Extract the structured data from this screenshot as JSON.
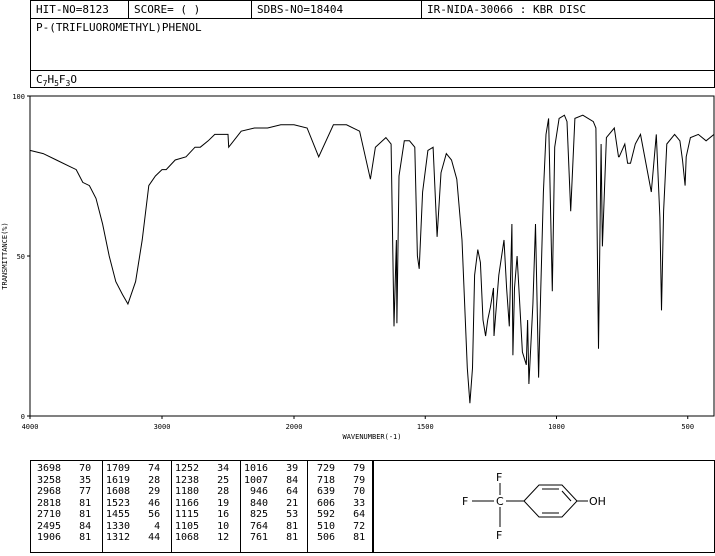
{
  "header": {
    "hit_no": "HIT-NO=8123",
    "score": "SCORE=  (   )",
    "sdbs_no": "SDBS-NO=18404",
    "ir_info": "IR-NIDA-30066 : KBR DISC"
  },
  "compound": {
    "name": "P-(TRIFLUOROMETHYL)PHENOL",
    "formula_parts": [
      "C",
      "7",
      "H",
      "5",
      "F",
      "3",
      "O"
    ]
  },
  "chart_data": {
    "type": "line",
    "xlabel": "WAVENUMBER(-1)",
    "ylabel": "TRANSMITTANCE(%)",
    "xlim": [
      4000,
      400
    ],
    "ylim": [
      0,
      100
    ],
    "x_ticks": [
      4000,
      3000,
      2000,
      1500,
      1000,
      500
    ],
    "y_ticks": [
      0,
      50,
      100
    ],
    "grid": false,
    "series": [
      {
        "x": [
          4000,
          3900,
          3800,
          3700,
          3650,
          3600,
          3550,
          3500,
          3450,
          3400,
          3350,
          3300,
          3258,
          3200,
          3150,
          3100,
          3050,
          3000,
          2968,
          2900,
          2818,
          2750,
          2710,
          2650,
          2600,
          2500,
          2495,
          2400,
          2300,
          2200,
          2100,
          2000,
          1950,
          1906,
          1850,
          1800,
          1750,
          1709,
          1690,
          1650,
          1630,
          1619,
          1610,
          1608,
          1600,
          1580,
          1560,
          1540,
          1530,
          1523,
          1510,
          1490,
          1470,
          1455,
          1440,
          1420,
          1400,
          1380,
          1360,
          1340,
          1330,
          1320,
          1312,
          1300,
          1290,
          1280,
          1270,
          1262,
          1252,
          1240,
          1238,
          1220,
          1200,
          1190,
          1180,
          1170,
          1166,
          1160,
          1150,
          1130,
          1115,
          1110,
          1105,
          1090,
          1080,
          1068,
          1060,
          1050,
          1040,
          1030,
          1016,
          1007,
          990,
          970,
          960,
          946,
          930,
          900,
          860,
          850,
          840,
          830,
          825,
          810,
          780,
          764,
          761,
          740,
          729,
          718,
          700,
          680,
          639,
          620,
          606,
          600,
          592,
          580,
          550,
          530,
          520,
          510,
          506,
          490,
          460,
          430,
          400
        ],
        "values": [
          83,
          82,
          80,
          78,
          77,
          73,
          72,
          68,
          60,
          50,
          42,
          38,
          35,
          42,
          55,
          72,
          75,
          77,
          77,
          80,
          81,
          84,
          84,
          86,
          88,
          88,
          84,
          89,
          90,
          90,
          91,
          91,
          90,
          81,
          91,
          91,
          89,
          74,
          84,
          87,
          85,
          28,
          55,
          29,
          75,
          86,
          86,
          84,
          50,
          46,
          70,
          83,
          84,
          56,
          76,
          82,
          80,
          74,
          55,
          15,
          4,
          15,
          44,
          52,
          48,
          30,
          25,
          30,
          34,
          40,
          25,
          44,
          55,
          40,
          28,
          60,
          19,
          40,
          50,
          20,
          16,
          30,
          10,
          35,
          60,
          12,
          40,
          70,
          88,
          93,
          39,
          84,
          93,
          94,
          92,
          64,
          93,
          94,
          92,
          90,
          21,
          85,
          53,
          87,
          90,
          81,
          81,
          85,
          79,
          79,
          85,
          88,
          70,
          88,
          62,
          33,
          64,
          85,
          88,
          86,
          80,
          72,
          81,
          87,
          88,
          86,
          88
        ]
      }
    ],
    "peak_table": [
      {
        "wn": 3698,
        "t": 70
      },
      {
        "wn": 3258,
        "t": 35
      },
      {
        "wn": 2968,
        "t": 77
      },
      {
        "wn": 2818,
        "t": 81
      },
      {
        "wn": 2710,
        "t": 81
      },
      {
        "wn": 2495,
        "t": 84
      },
      {
        "wn": 1906,
        "t": 81
      },
      {
        "wn": 1709,
        "t": 74
      },
      {
        "wn": 1619,
        "t": 28
      },
      {
        "wn": 1608,
        "t": 29
      },
      {
        "wn": 1523,
        "t": 46
      },
      {
        "wn": 1455,
        "t": 56
      },
      {
        "wn": 1330,
        "t": 4
      },
      {
        "wn": 1312,
        "t": 44
      },
      {
        "wn": 1252,
        "t": 34
      },
      {
        "wn": 1238,
        "t": 25
      },
      {
        "wn": 1180,
        "t": 28
      },
      {
        "wn": 1166,
        "t": 19
      },
      {
        "wn": 1115,
        "t": 16
      },
      {
        "wn": 1105,
        "t": 10
      },
      {
        "wn": 1068,
        "t": 12
      },
      {
        "wn": 1016,
        "t": 39
      },
      {
        "wn": 1007,
        "t": 84
      },
      {
        "wn": 946,
        "t": 64
      },
      {
        "wn": 840,
        "t": 21
      },
      {
        "wn": 825,
        "t": 53
      },
      {
        "wn": 764,
        "t": 81
      },
      {
        "wn": 761,
        "t": 81
      },
      {
        "wn": 729,
        "t": 79
      },
      {
        "wn": 718,
        "t": 79
      },
      {
        "wn": 639,
        "t": 70
      },
      {
        "wn": 606,
        "t": 33
      },
      {
        "wn": 592,
        "t": 64
      },
      {
        "wn": 510,
        "t": 72
      },
      {
        "wn": 506,
        "t": 81
      }
    ]
  },
  "structure": {
    "f_top": "F",
    "f_left": "F",
    "f_bottom": "F",
    "c_label": "C",
    "oh_label": "OH"
  }
}
